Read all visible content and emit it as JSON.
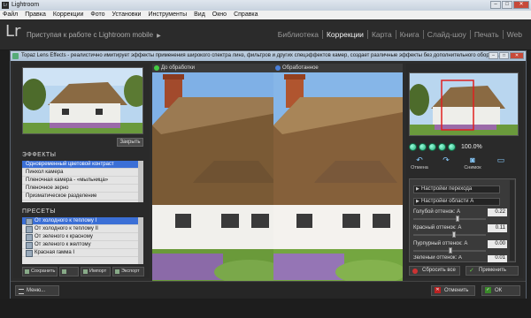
{
  "window": {
    "title": "Lightroom",
    "controls": [
      "–",
      "□",
      "✕"
    ]
  },
  "menu": [
    "Файл",
    "Правка",
    "Коррекции",
    "Фото",
    "Установки",
    "Инструменты",
    "Вид",
    "Окно",
    "Справка"
  ],
  "lr": {
    "logo": "Lr",
    "mobile_text": "Приступая к работе с Lightroom mobile",
    "mobile_arrow": "▶",
    "modules": [
      "Библиотека",
      "Коррекции",
      "Карта",
      "Книга",
      "Слайд-шоу",
      "Печать",
      "Web"
    ],
    "active_module": "Коррекции"
  },
  "dialog": {
    "title": "Topaz Lens Effects - реалистично имитирует эффекты применения широкого спектра линз, фильтров и других спецэффектов камер, создает различные эффекты без дополнительного оборуд...",
    "controls": [
      "–",
      "□",
      "✕"
    ],
    "close_label": "Закрыть",
    "effects_heading": "ЭФФЕКТЫ",
    "effects": [
      "Одновременный цветовой контраст",
      "Пинхол камера",
      "Пленочная камера - «мыльница»",
      "Пленочное зерно",
      "Призматическое разделение"
    ],
    "selected_effect": 0,
    "presets_heading": "ПРЕСЕТЫ",
    "presets": [
      "От холодного к теплому I",
      "От холодного к теплому II",
      "От зеленого к красному",
      "От зеленого к желтому",
      "Красная гамма I"
    ],
    "selected_preset": 0,
    "preset_buttons": [
      "Сохранить",
      "",
      "Импорт",
      "Экспорт"
    ],
    "before_label": "До обработки",
    "after_label": "Обработанное",
    "zoom": "100.0%",
    "tools": [
      "Отмена",
      "",
      "Снимок",
      ""
    ],
    "sections": [
      "Настройки перехода",
      "Настройки области A"
    ],
    "adjustments": [
      {
        "label": "Голубой оттенок: A",
        "value": "0.22"
      },
      {
        "label": "Красный оттенок: A",
        "value": "0.11"
      },
      {
        "label": "Пурпурный оттенок: A",
        "value": "0.00"
      },
      {
        "label": "Зеленый оттенок: A",
        "value": "0.01"
      }
    ],
    "reset_label": "Сбросить все",
    "apply_label": "Применить",
    "menu_label": "Меню...",
    "cancel_label": "Отменить",
    "ok_label": "ОК"
  },
  "colors": {
    "selection": "#3b6fd6",
    "accent_before": "#4c4",
    "accent_after": "#4a7fd8",
    "nav_frame": "#e02020"
  }
}
